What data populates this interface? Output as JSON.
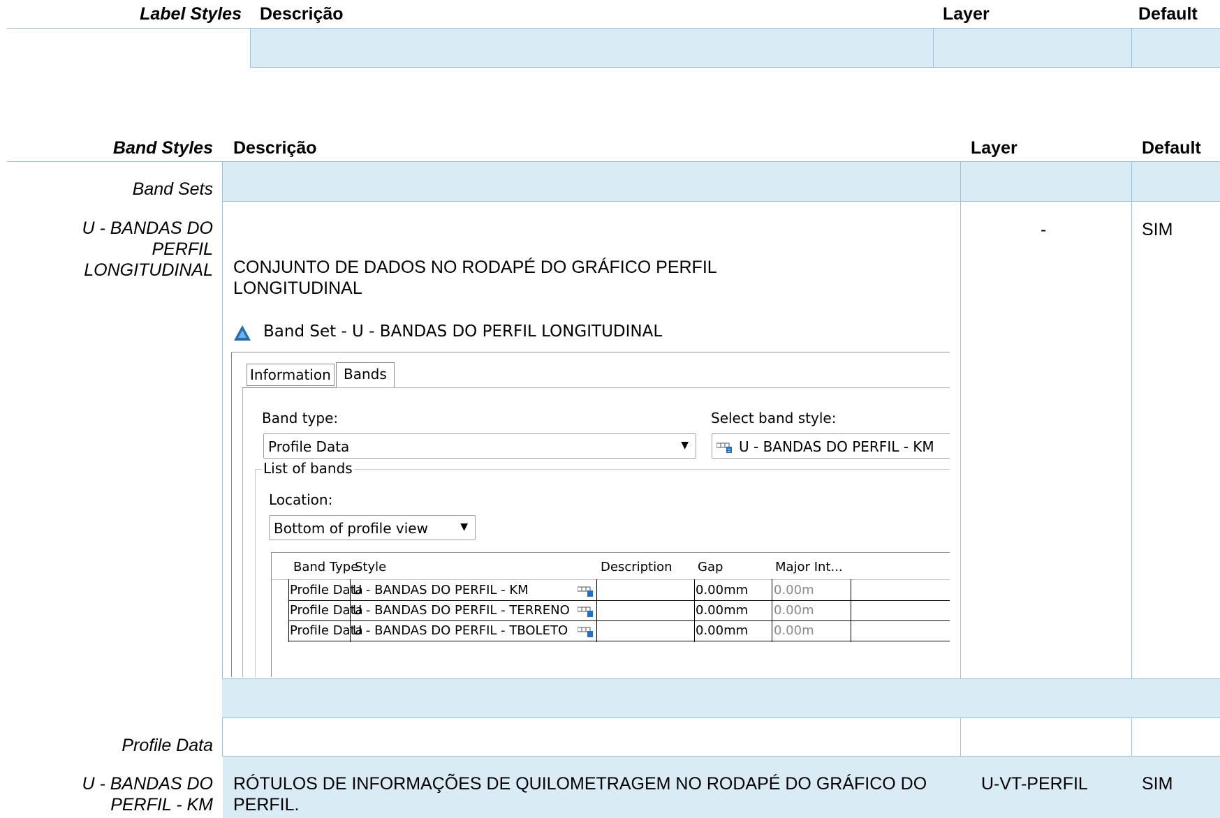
{
  "label_styles": {
    "title": "Label Styles",
    "col_descricao": "Descrição",
    "col_layer": "Layer",
    "col_default": "Default"
  },
  "band_styles": {
    "title": "Band Styles",
    "col_descricao": "Descrição",
    "col_layer": "Layer",
    "col_default": "Default",
    "band_sets_label": "Band Sets",
    "row1": {
      "name": "U - BANDAS DO PERFIL LONGITUDINAL",
      "description": "CONJUNTO DE DADOS NO RODAPÉ DO GRÁFICO PERFIL LONGITUDINAL",
      "layer": "-",
      "default": "SIM"
    },
    "profile_data_label": "Profile Data",
    "row2": {
      "name": "U - BANDAS DO PERFIL - KM",
      "description": "RÓTULOS DE INFORMAÇÕES DE QUILOMETRAGEM NO RODAPÉ DO GRÁFICO DO PERFIL.",
      "layer": "U-VT-PERFIL",
      "default": "SIM"
    }
  },
  "dialog": {
    "title": "Band Set - U - BANDAS DO PERFIL LONGITUDINAL",
    "tabs": [
      "Information",
      "Bands"
    ],
    "band_type_label": "Band type:",
    "band_type_value": "Profile Data",
    "select_style_label": "Select band style:",
    "select_style_value": "U - BANDAS DO PERFIL - KM",
    "list_of_bands": "List of bands",
    "location_label": "Location:",
    "location_value": "Bottom of profile view",
    "columns": [
      "Band Type",
      "Style",
      "Description",
      "Gap",
      "Major Int..."
    ],
    "rows": [
      {
        "band_type": "Profile Data",
        "style": "U - BANDAS DO PERFIL - KM",
        "description": "",
        "gap": "0.00mm",
        "major": "0.00m"
      },
      {
        "band_type": "Profile Data",
        "style": "U - BANDAS DO PERFIL - TERRENO",
        "description": "",
        "gap": "0.00mm",
        "major": "0.00m"
      },
      {
        "band_type": "Profile Data",
        "style": "U - BANDAS DO PERFIL - TBOLETO",
        "description": "",
        "gap": "0.00mm",
        "major": "0.00m"
      }
    ],
    "colors": {
      "app_icon": "#1f6fb5",
      "grid_icon": "#1e6fd0"
    },
    "icons": {
      "app": "autocad-app-icon",
      "band_style": "band-style-icon"
    }
  }
}
